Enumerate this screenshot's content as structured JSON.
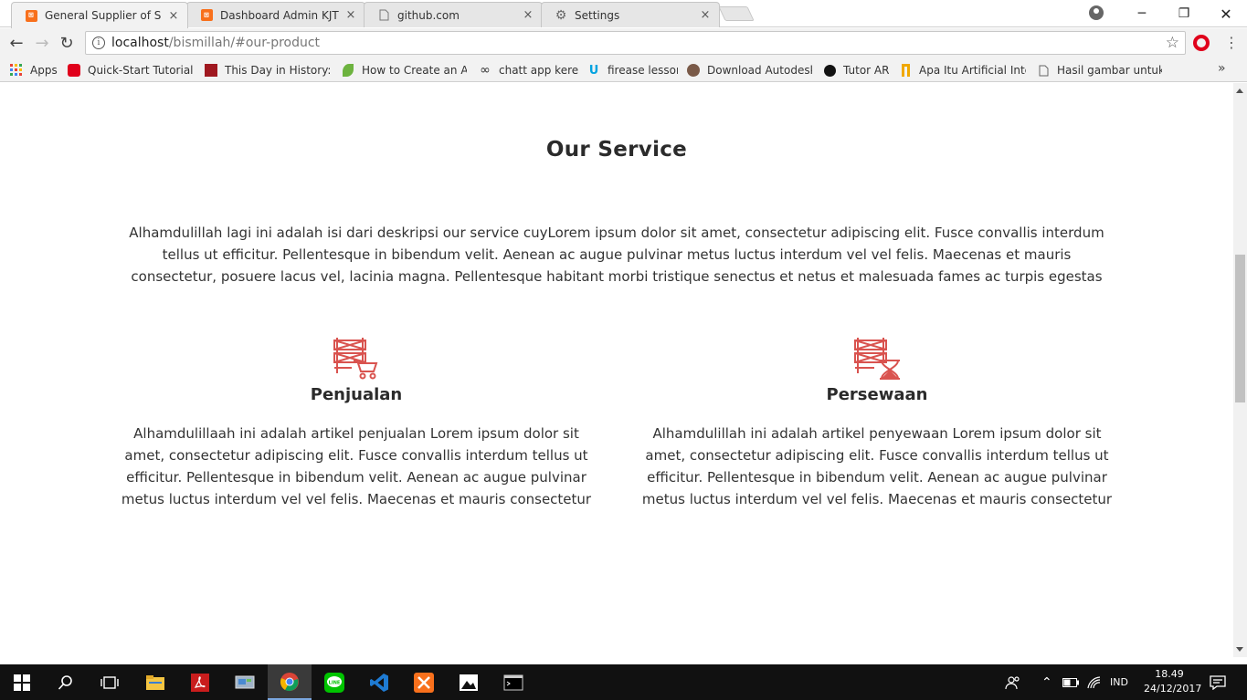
{
  "browser": {
    "tabs": [
      {
        "title": "General Supplier of Scaff",
        "active": true,
        "icon": "xampp-icon"
      },
      {
        "title": "Dashboard Admin KJT",
        "active": false,
        "icon": "xampp-icon"
      },
      {
        "title": "github.com",
        "active": false,
        "icon": "page-icon"
      },
      {
        "title": "Settings",
        "active": false,
        "icon": "gear-icon"
      }
    ],
    "close_glyph": "×",
    "url_host": "localhost",
    "url_path": "/bismillah/#our-product",
    "bookmarks": [
      {
        "label": "Apps",
        "icon": "apps-grid-icon"
      },
      {
        "label": "Quick-Start Tutorial U",
        "icon": "oracle-icon"
      },
      {
        "label": "This Day in History: A",
        "icon": "history-icon"
      },
      {
        "label": "How to Create an An",
        "icon": "leaf-icon"
      },
      {
        "label": "chatt app keren",
        "icon": "infinity-icon"
      },
      {
        "label": "firease lesson",
        "icon": "udemy-icon"
      },
      {
        "label": "Download Autodesk",
        "icon": "autodesk-icon"
      },
      {
        "label": "Tutor AR",
        "icon": "circle-icon"
      },
      {
        "label": "Apa Itu Artificial Intel",
        "icon": "bookmark-icon"
      },
      {
        "label": "Hasil gambar untuk v",
        "icon": "page-icon"
      }
    ]
  },
  "page": {
    "title": "Our Service",
    "description": "Alhamdulillah lagi ini adalah isi dari deskripsi our service cuyLorem ipsum dolor sit amet, consectetur adipiscing elit. Fusce convallis interdum tellus ut efficitur. Pellentesque in bibendum velit. Aenean ac augue pulvinar metus luctus interdum vel vel felis. Maecenas et mauris consectetur, posuere lacus vel, lacinia magna. Pellentesque habitant morbi tristique senectus et netus et malesuada fames ac turpis egestas",
    "services": [
      {
        "name": "Penjualan",
        "icon": "scaffold-cart-icon",
        "text": "Alhamdulillaah ini adalah artikel penjualan Lorem ipsum dolor sit amet, consectetur adipiscing elit. Fusce convallis interdum tellus ut efficitur. Pellentesque in bibendum velit. Aenean ac augue pulvinar metus luctus interdum vel vel felis. Maecenas et mauris consectetur"
      },
      {
        "name": "Persewaan",
        "icon": "scaffold-hourglass-icon",
        "text": "Alhamdulillah ini adalah artikel penyewaan Lorem ipsum dolor sit amet, consectetur adipiscing elit. Fusce convallis interdum tellus ut efficitur. Pellentesque in bibendum velit. Aenean ac augue pulvinar metus luctus interdum vel vel felis. Maecenas et mauris consectetur"
      }
    ],
    "accent_color": "#d9534f"
  },
  "taskbar": {
    "language": "IND",
    "time": "18.49",
    "date": "24/12/2017",
    "apps": [
      "windows-start-icon",
      "search-icon",
      "task-view-icon",
      "file-explorer-icon",
      "acrobat-icon",
      "control-panel-icon",
      "chrome-icon",
      "line-icon",
      "vscode-icon",
      "xampp-icon",
      "photos-icon",
      "terminal-icon"
    ]
  }
}
